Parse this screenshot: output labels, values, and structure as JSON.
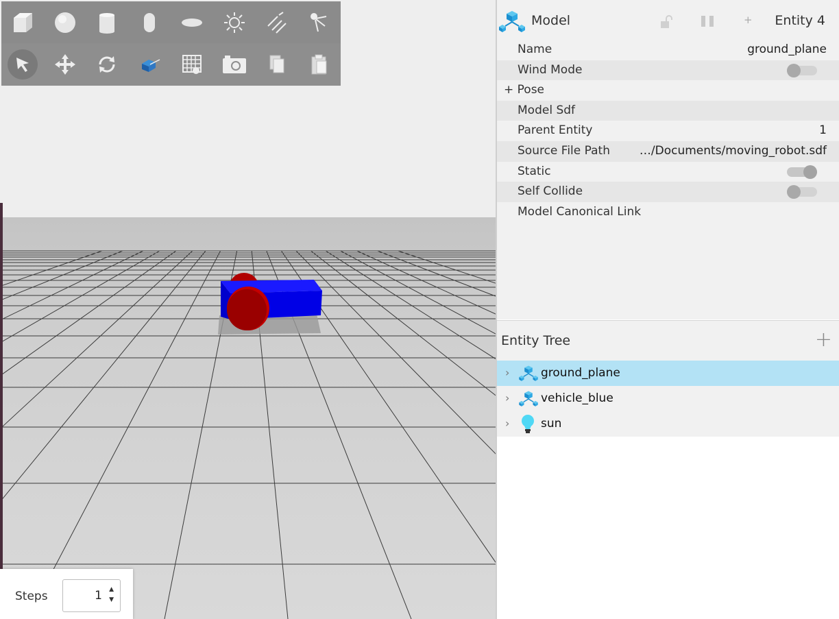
{
  "window_title": "",
  "viewport": {
    "shape_tools": [
      "box-icon",
      "sphere-icon",
      "cylinder-icon",
      "capsule-icon",
      "ellipsoid-icon",
      "point-light-icon",
      "directional-light-icon",
      "spot-light-icon"
    ],
    "transform_tools": [
      "select-icon",
      "translate-icon",
      "rotate-icon",
      "view-angle-icon",
      "grid-config-icon",
      "screenshot-icon",
      "copy-icon",
      "paste-icon"
    ],
    "active_tool": "select",
    "colors": {
      "sky": "#eeeeee",
      "ground": "#d4d4d4",
      "robot_body": "#0000e0",
      "robot_wheel": "#a00000"
    }
  },
  "steps": {
    "label": "Steps",
    "value": "1"
  },
  "component_inspector": {
    "title": "Model",
    "entity_label": "Entity 4",
    "lock_icon": "unlock-icon",
    "pause_icon": "pause-icon",
    "plus_label": "+",
    "rows": [
      {
        "name": "Name",
        "value": "ground_plane"
      },
      {
        "name": "Wind Mode",
        "toggle": "off"
      },
      {
        "name": "Pose",
        "expander": "+"
      },
      {
        "name": "Model Sdf",
        "value": ""
      },
      {
        "name": "Parent Entity",
        "value": "1"
      },
      {
        "name": "Source File Path",
        "value": "…/Documents/moving_robot.sdf"
      },
      {
        "name": "Static",
        "toggle": "on"
      },
      {
        "name": "Self Collide",
        "toggle": "off"
      },
      {
        "name": "Model Canonical Link",
        "value": ""
      }
    ]
  },
  "entity_tree": {
    "title": "Entity Tree",
    "add_label": "+",
    "items": [
      {
        "label": "ground_plane",
        "icon": "model-icon",
        "selected": true
      },
      {
        "label": "vehicle_blue",
        "icon": "model-icon",
        "selected": false
      },
      {
        "label": "sun",
        "icon": "light-bulb-icon",
        "selected": false
      }
    ],
    "selection_color": "#b3e2f5"
  }
}
